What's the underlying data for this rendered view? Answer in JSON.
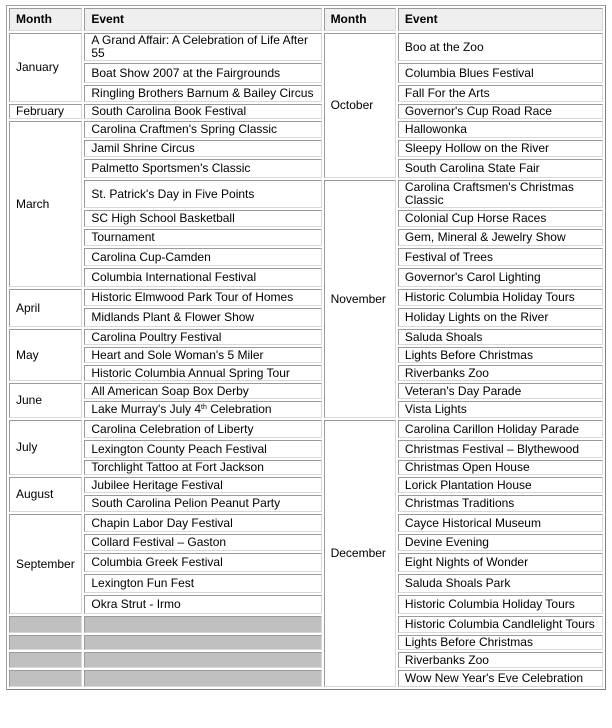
{
  "headers": {
    "left_month": "Month",
    "left_event": "Event",
    "right_month": "Month",
    "right_event": "Event"
  },
  "left_months": {
    "january": "January",
    "february": "February",
    "march": "March",
    "april": "April",
    "may": "May",
    "june": "June",
    "july": "July",
    "august": "August",
    "september": "September"
  },
  "right_months": {
    "october": "October",
    "november": "November",
    "december": "December"
  },
  "left_events": [
    "A Grand Affair: A Celebration of Life After 55",
    "Boat Show 2007 at the Fairgrounds",
    "Ringling Brothers Barnum & Bailey Circus",
    "South Carolina Book Festival",
    "Carolina Craftmen's Spring Classic",
    "Jamil Shrine Circus",
    "Palmetto Sportsmen's Classic",
    "St. Patrick's Day in Five Points",
    "SC High School Basketball",
    "Tournament",
    "Carolina Cup-Camden",
    "Columbia International Festival",
    "Historic Elmwood Park Tour of Homes",
    "Midlands Plant & Flower Show",
    "Carolina Poultry Festival",
    "Heart and Sole Woman's 5 Miler",
    "Historic Columbia Annual Spring Tour",
    "All American Soap Box Derby",
    "Lake Murray's July 4",
    "Carolina Celebration of Liberty",
    "Lexington County Peach Festival",
    "Torchlight Tattoo at Fort Jackson",
    "Jubilee Heritage Festival",
    "South Carolina Pelion Peanut Party",
    "Chapin Labor Day Festival",
    "Collard Festival – Gaston",
    "Columbia Greek Festival",
    "Lexington Fun Fest",
    "Okra Strut - Irmo"
  ],
  "lake_murray_suffix": {
    "ordinal": "th",
    "rest": " Celebration"
  },
  "right_events": [
    "Boo at the Zoo",
    "Columbia Blues Festival",
    "Fall For the Arts",
    "Governor's Cup Road Race",
    "Hallowonka",
    "Sleepy Hollow on the River",
    "South Carolina State Fair",
    "Carolina Craftsmen's Christmas Classic",
    "Colonial Cup Horse Races",
    "Gem, Mineral & Jewelry Show",
    "Festival of Trees",
    "Governor's Carol Lighting",
    "Historic Columbia Holiday Tours",
    "Holiday Lights on the River",
    "Saluda Shoals",
    "Lights Before Christmas",
    "Riverbanks Zoo",
    "Veteran's Day Parade",
    "Vista Lights",
    "Carolina Carillon Holiday Parade",
    "Christmas Festival – Blythewood",
    "Christmas Open House",
    "Lorick Plantation House",
    "Christmas Traditions",
    "Cayce Historical Museum",
    "Devine Evening",
    "Eight Nights of Wonder",
    "Saluda Shoals Park",
    "Historic Columbia Holiday Tours",
    "Historic Columbia Candlelight Tours",
    "Lights Before Christmas",
    "Riverbanks Zoo",
    "Wow New Year's Eve Celebration"
  ],
  "colors": {
    "header_bg": "#efefef",
    "empty_cell_bg": "#c0c0c0",
    "border": "#a0a0a0"
  }
}
